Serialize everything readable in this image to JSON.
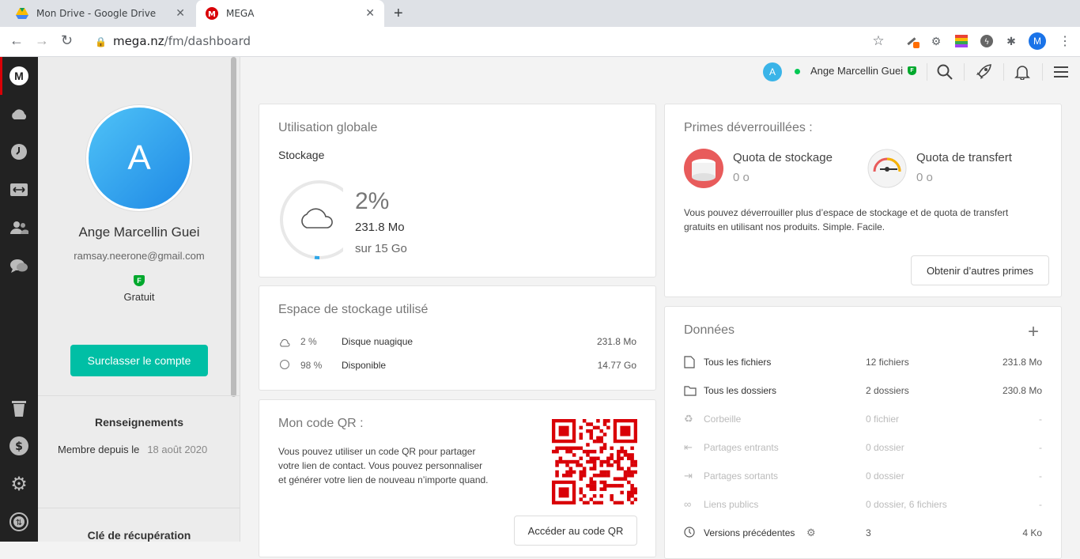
{
  "browser": {
    "tabs": [
      {
        "title": "Mon Drive - Google Drive"
      },
      {
        "title": "MEGA"
      }
    ],
    "url_host": "mega.nz",
    "url_path": "/fm/dashboard",
    "profile_initial": "M"
  },
  "profile": {
    "initial": "A",
    "name": "Ange Marcellin Guei",
    "email": "ramsay.neerone@gmail.com",
    "plan_badge": "F",
    "plan": "Gratuit",
    "upgrade_label": "Surclasser le compte",
    "info_title": "Renseignements",
    "member_label": "Membre depuis le",
    "member_date": "18 août 2020",
    "recovery_title": "Clé de récupération"
  },
  "topbar": {
    "initial": "A",
    "name": "Ange Marcellin Guei",
    "badge": "F"
  },
  "usage": {
    "title": "Utilisation globale",
    "subtitle": "Stockage",
    "percent_label": "2%",
    "percent": 2,
    "used": "231.8 Mo",
    "total": "sur 15 Go"
  },
  "storage": {
    "title": "Espace de stockage utilisé",
    "rows": [
      {
        "pct": "2 %",
        "label": "Disque nuagique",
        "size": "231.8 Mo"
      },
      {
        "pct": "98 %",
        "label": "Disponible",
        "size": "14.77 Go"
      }
    ]
  },
  "qr": {
    "title": "Mon code QR :",
    "desc1": "Vous pouvez utiliser un code QR pour partager",
    "desc2": "votre lien de contact. Vous pouvez personnaliser",
    "desc3": "et générer votre lien de nouveau n’importe quand.",
    "button": "Accéder au code QR"
  },
  "rewards": {
    "title": "Primes déverrouillées :",
    "storage_label": "Quota de stockage",
    "storage_value": "0 o",
    "transfer_label": "Quota de transfert",
    "transfer_value": "0 o",
    "desc1": "Vous pouvez déverrouiller plus d’espace de stockage et de quota de transfert",
    "desc2": "gratuits en utilisant nos produits. Simple. Facile.",
    "button": "Obtenir d’autres primes"
  },
  "data_section": {
    "title": "Données",
    "rows": [
      {
        "label": "Tous les fichiers",
        "count": "12 fichiers",
        "size": "231.8 Mo"
      },
      {
        "label": "Tous les dossiers",
        "count": "2 dossiers",
        "size": "230.8 Mo"
      },
      {
        "label": "Corbeille",
        "count": "0 fichier",
        "size": "-"
      },
      {
        "label": "Partages entrants",
        "count": "0 dossier",
        "size": "-"
      },
      {
        "label": "Partages sortants",
        "count": "0 dossier",
        "size": "-"
      },
      {
        "label": "Liens publics",
        "count": "0 dossier, 6 fichiers",
        "size": "-"
      },
      {
        "label": "Versions précédentes",
        "count": "3",
        "size": "4 Ko"
      }
    ]
  },
  "colors": {
    "accent": "#00bfa5",
    "mega_red": "#d90007",
    "avatar": "#2ea6e8"
  }
}
